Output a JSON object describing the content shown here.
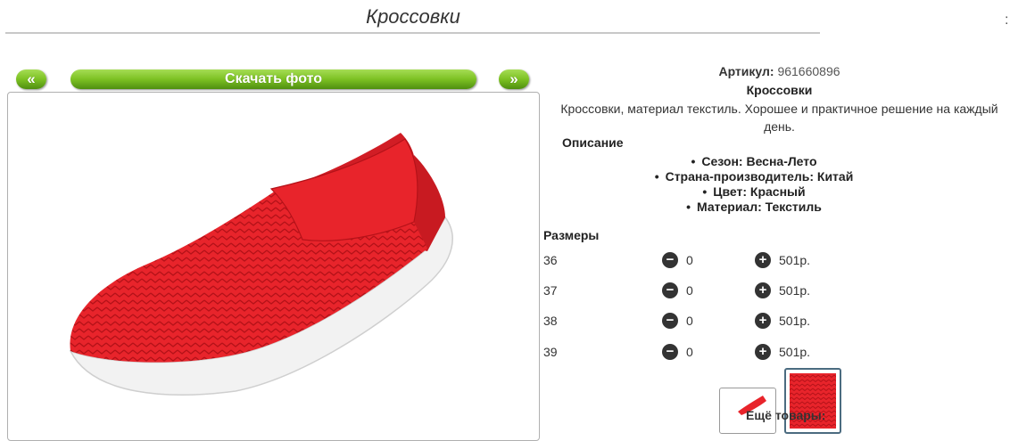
{
  "page": {
    "title": "Кроссовки",
    "edge_mark": ":"
  },
  "gallery": {
    "prev_label": "«",
    "next_label": "»",
    "download_label": "Скачать фото"
  },
  "product": {
    "sku_label": "Артикул:",
    "sku": "961660896",
    "name": "Кроссовки",
    "description": "Кроссовки, материал текстиль. Хорошее и практичное решение на каждый день.",
    "description_heading": "Описание",
    "features": [
      "Сезон: Весна-Лето",
      "Страна-производитель: Китай",
      "Цвет: Красный",
      "Материал: Текстиль"
    ]
  },
  "sizes": {
    "heading": "Размеры",
    "rows": [
      {
        "size": "36",
        "qty": "0",
        "price": "501р."
      },
      {
        "size": "37",
        "qty": "0",
        "price": "501р."
      },
      {
        "size": "38",
        "qty": "0",
        "price": "501р."
      },
      {
        "size": "39",
        "qty": "0",
        "price": "501р."
      }
    ]
  },
  "more_goods_label": "Ещё товары:",
  "icons": {
    "minus": "minus-circle-icon",
    "plus": "plus-circle-icon"
  },
  "colors": {
    "button_green": "#7cc123",
    "shoe_red": "#e8242b",
    "sole_white": "#f2f2f2"
  }
}
